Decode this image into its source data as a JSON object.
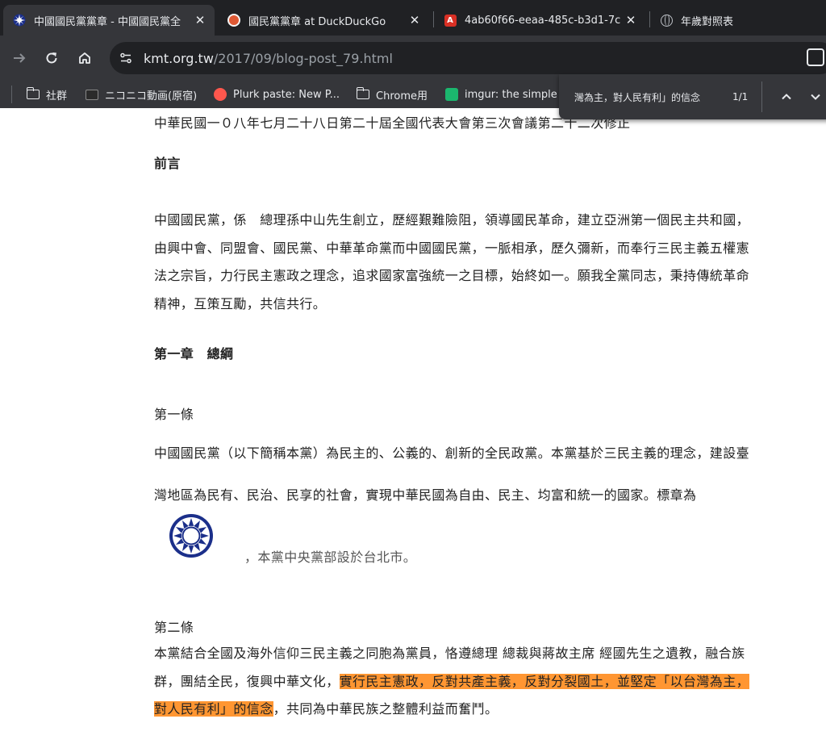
{
  "tabs": [
    {
      "title": "中國國民黨黨章 - 中國國民黨全",
      "favicon": "kmt-emblem-icon",
      "active": true
    },
    {
      "title": "國民黨黨章 at DuckDuckGo",
      "favicon": "duckduckgo-icon",
      "active": false
    },
    {
      "title": "4ab60f66-eeaa-485c-b3d1-7c",
      "favicon": "pdf-icon",
      "active": false
    },
    {
      "title": "年歲對照表",
      "favicon": "globe-icon",
      "active": false
    }
  ],
  "toolbar": {
    "url_host": "kmt.org.tw",
    "url_path": "/2017/09/blog-post_79.html"
  },
  "bookmarks": [
    {
      "label": "社群",
      "icon": "folder-icon"
    },
    {
      "label": "ニコニコ動画(原宿)",
      "icon": "niconico-icon"
    },
    {
      "label": "Plurk paste: New P...",
      "icon": "plurk-icon"
    },
    {
      "label": "Chrome用",
      "icon": "folder-icon"
    },
    {
      "label": "imgur: the simple i",
      "icon": "imgur-icon"
    }
  ],
  "find": {
    "query": "灣為主，對人民有利」的信念",
    "count": "1/1"
  },
  "article": {
    "amendment_line": "中華民國一０八年七月二十八日第二十屆全國代表大會第三次會議第二十二次修正",
    "preface_heading": "前言",
    "intro_lines": [
      "中國國民黨，係　總理孫中山先生創立，歷經艱難險阻，領導國民革命，建立亞洲第一個民主共和國，",
      "由興中會、同盟會、國民黨、中華革命黨而中國國民黨，一脈相承，歷久彌新，而奉行三民主義五權憲",
      "法之宗旨，力行民主憲政之理念，追求國家富強統一之目標，始終如一。願我全黨同志，秉持傳統革命",
      "精神，互策互勵，共信共行。"
    ],
    "chapter_heading": "第一章　總綱",
    "art1_title": "第一條",
    "art1_line1": "中國國民黨（以下簡稱本黨）為民主的、公義的、創新的全民政黨。本黨基於三民主義的理念，建設臺",
    "art1_line2": "灣地區為民有、民治、民享的社會，實現中華民國為自由、民主、均富和統一的國家。標章為",
    "art1_hq": "，本黨中央黨部設於台北市。",
    "art2_title": "第二條",
    "art2_line1": "本黨結合全國及海外信仰三民主義之同胞為黨員，恪遵總理 總裁與蔣故主席 經國先生之遺教，融合族",
    "art2_line2_plain": "群，團結全民，復興中華文化，",
    "art2_line2_hl": "實行民主憲政，反對共產主義，反對分裂國土，並堅定「以台灣為主，",
    "art2_line3_hl": "對人民有利」的信念",
    "art2_line3_plain": "，共同為中華民族之整體利益而奮鬥。"
  },
  "colors": {
    "highlight": "#ff9632",
    "emblem_blue": "#1b2f8a"
  }
}
